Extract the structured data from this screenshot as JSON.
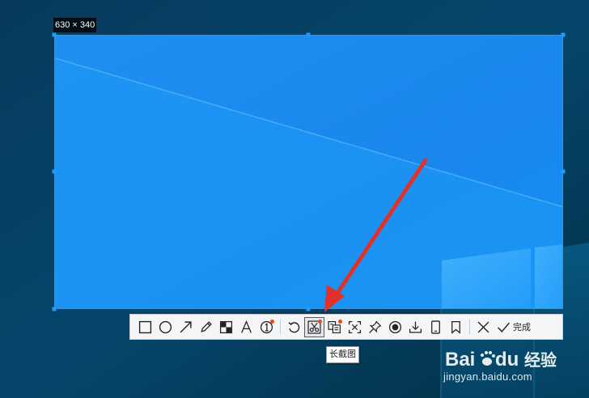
{
  "selection": {
    "size_label": "630 × 340"
  },
  "toolbar": {
    "tools": [
      {
        "name": "rectangle-tool",
        "icon": "rectangle-icon"
      },
      {
        "name": "ellipse-tool",
        "icon": "circle-icon"
      },
      {
        "name": "arrow-tool",
        "icon": "arrow-icon"
      },
      {
        "name": "pen-tool",
        "icon": "pencil-icon"
      },
      {
        "name": "mosaic-tool",
        "icon": "mosaic-icon"
      },
      {
        "name": "text-tool",
        "icon": "text-icon"
      },
      {
        "name": "number-tool",
        "icon": "number-icon"
      },
      {
        "name": "undo-tool",
        "icon": "undo-icon"
      },
      {
        "name": "long-screenshot-tool",
        "icon": "long-screenshot-icon"
      },
      {
        "name": "ocr-tool",
        "icon": "ocr-icon"
      },
      {
        "name": "scan-tool",
        "icon": "scan-icon"
      },
      {
        "name": "pin-tool",
        "icon": "pin-icon"
      },
      {
        "name": "record-tool",
        "icon": "record-icon"
      },
      {
        "name": "download-tool",
        "icon": "download-icon"
      },
      {
        "name": "phone-tool",
        "icon": "phone-icon"
      },
      {
        "name": "bookmark-tool",
        "icon": "bookmark-icon"
      },
      {
        "name": "close-tool",
        "icon": "close-icon"
      }
    ],
    "done_label": "完成"
  },
  "tooltip": {
    "text": "长截图"
  },
  "watermark": {
    "logo_text": "Bai",
    "logo_suffix": "du",
    "jingyan": "经验",
    "url": "jingyan.baidu.com"
  },
  "colors": {
    "selection_border": "#1e9bff",
    "arrow": "#e0322b",
    "badge": "#e34b1f"
  }
}
